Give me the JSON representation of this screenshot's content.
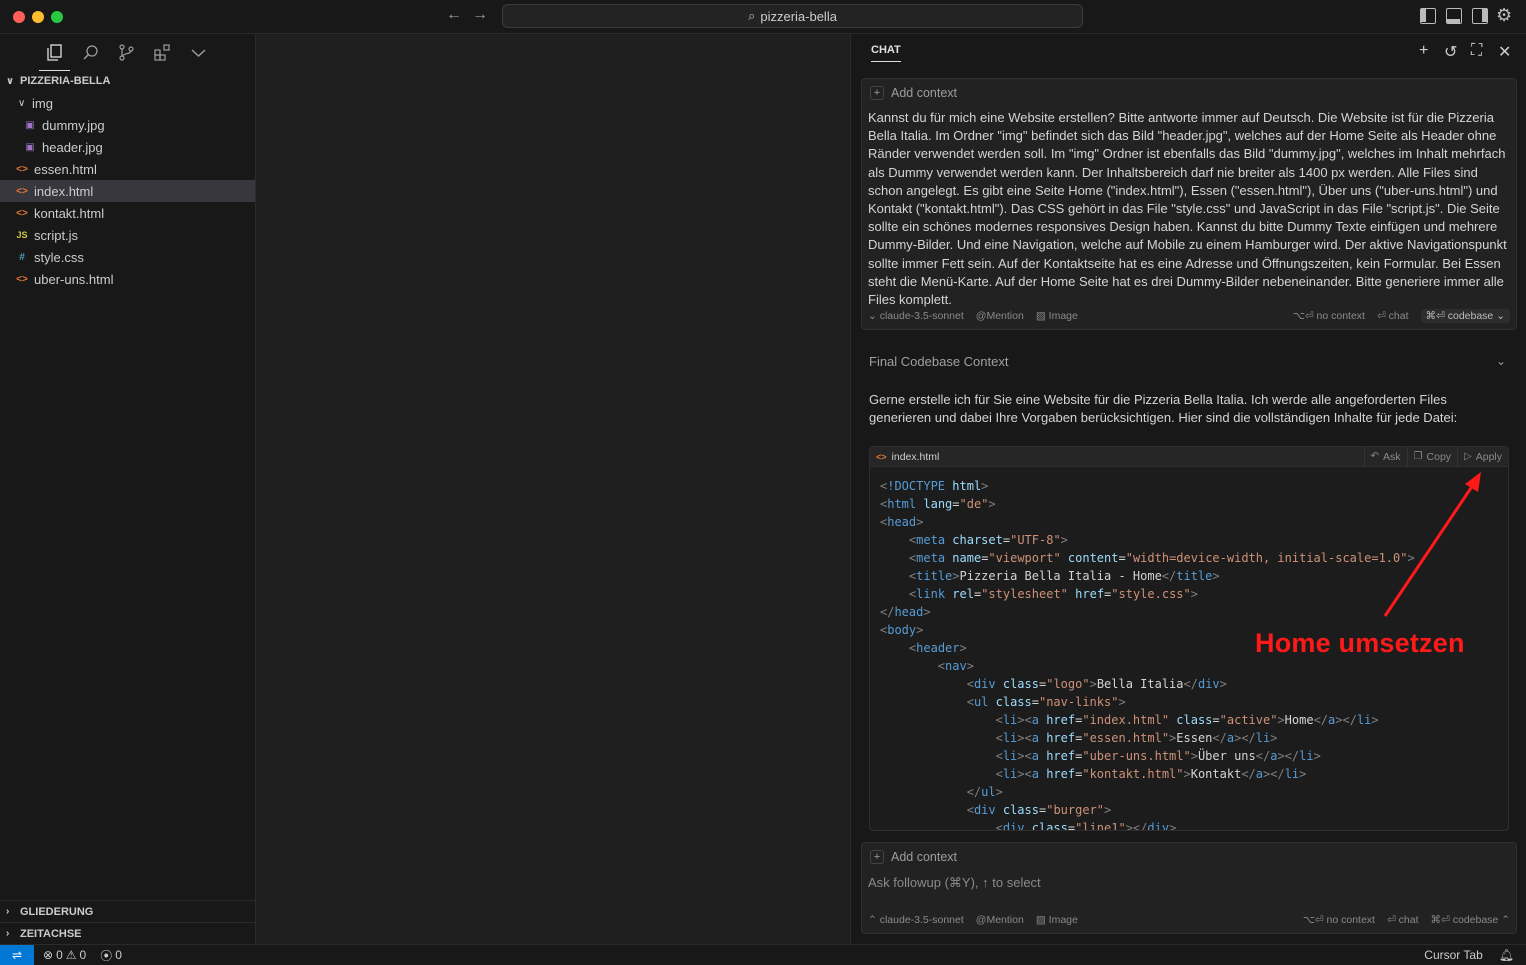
{
  "window": {
    "search_title": "pizzeria-bella"
  },
  "explorer": {
    "root": "PIZZERIA-BELLA",
    "folder": "img",
    "folder_files": [
      "dummy.jpg",
      "header.jpg"
    ],
    "files": [
      {
        "name": "essen.html",
        "type": "html"
      },
      {
        "name": "index.html",
        "type": "html",
        "selected": true
      },
      {
        "name": "kontakt.html",
        "type": "html"
      },
      {
        "name": "script.js",
        "type": "js"
      },
      {
        "name": "style.css",
        "type": "css"
      },
      {
        "name": "uber-uns.html",
        "type": "html"
      }
    ],
    "outline": "GLIEDERUNG",
    "timeline": "ZEITACHSE"
  },
  "chat": {
    "tab": "CHAT",
    "add_context": "Add context",
    "user_message": "Kannst du für mich eine Website erstellen? Bitte antworte immer auf Deutsch. Die Website ist für die Pizzeria Bella Italia. Im Ordner \"img\" befindet sich das Bild \"header.jpg\", welches auf der Home Seite als Header ohne Ränder verwendet werden soll. Im \"img\" Ordner ist ebenfalls das Bild \"dummy.jpg\", welches im Inhalt mehrfach als Dummy verwendet werden kann. Der Inhaltsbereich darf nie breiter als 1400 px werden. Alle Files sind schon angelegt. Es gibt eine Seite Home (\"index.html\"), Essen (\"essen.html\"), Über uns (\"uber-uns.html\") und Kontakt (\"kontakt.html\"). Das CSS gehört in das File \"style.css\" und JavaScript in das File \"script.js\". Die Seite sollte ein schönes modernes responsives Design haben. Kannst du bitte Dummy Texte einfügen und mehrere Dummy-Bilder. Und eine Navigation, welche auf Mobile zu einem Hamburger wird. Der aktive Navigationspunkt sollte immer Fett sein. Auf der Kontaktseite hat es eine Adresse und Öffnungszeiten, kein Formular. Bei Essen steht die Menü-Karte. Auf der Home Seite hat es drei Dummy-Bilder nebeneinander. Bitte generiere immer alle Files komplett.",
    "model": "claude-3.5-sonnet",
    "mention": "Mention",
    "image": "Image",
    "no_context": "⌥⏎ no context",
    "chat_shortcut": "⏎ chat",
    "codebase": "⌘⏎ codebase",
    "final_context": "Final Codebase Context",
    "answer": "Gerne erstelle ich für Sie eine Website für die Pizzeria Bella Italia. Ich werde alle angeforderten Files generieren und dabei Ihre Vorgaben berücksichtigen. Hier sind die vollständigen Inhalte für jede Datei:",
    "code_file": "index.html",
    "code_buttons": [
      "Ask",
      "Copy",
      "Apply"
    ],
    "annotation": "Home umsetzen",
    "followup_placeholder": "Ask followup (⌘Y), ↑ to select"
  },
  "status": {
    "errors": "0",
    "warnings": "0",
    "ports": "0",
    "cursor_tab": "Cursor Tab"
  },
  "colors": {
    "accent": "#0078d4",
    "annotation": "#ff1a1a"
  }
}
